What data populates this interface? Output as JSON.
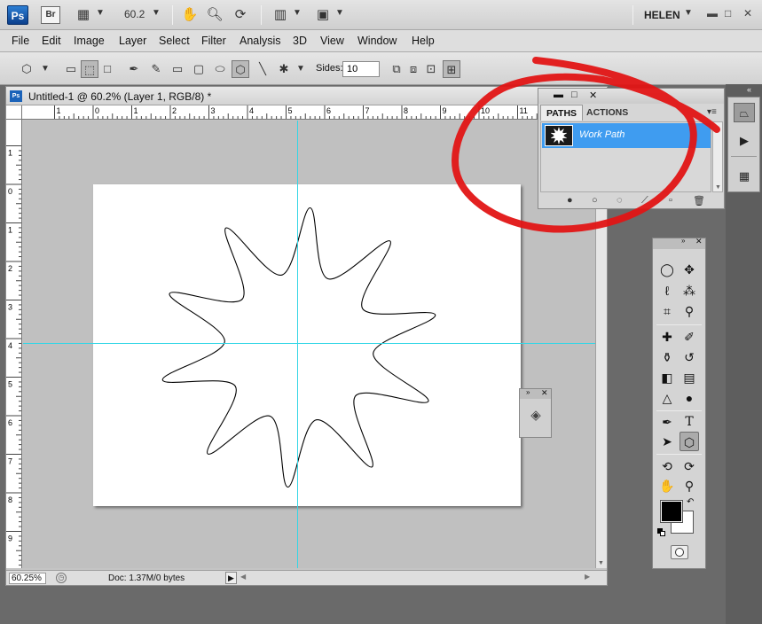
{
  "app_bar": {
    "ps_logo": "Ps",
    "br_logo": "Br",
    "zoom": "60.2",
    "username": "HELEN"
  },
  "menu": [
    "File",
    "Edit",
    "Image",
    "Layer",
    "Select",
    "Filter",
    "Analysis",
    "3D",
    "View",
    "Window",
    "Help"
  ],
  "options_bar": {
    "sides_label": "Sides:",
    "sides_value": "10"
  },
  "document": {
    "title": "Untitled-1 @ 60.2% (Layer 1, RGB/8) *",
    "zoom_status": "60.25%",
    "doc_info": "Doc: 1.37M/0 bytes",
    "ruler_h_labels": [
      "1",
      "0",
      "1",
      "2",
      "3",
      "4",
      "5",
      "6",
      "7",
      "8",
      "9",
      "10",
      "11"
    ],
    "ruler_v_labels": [
      "1",
      "0",
      "1",
      "2",
      "3",
      "4",
      "5",
      "6",
      "7",
      "8",
      "9"
    ]
  },
  "paths_panel": {
    "tabs": [
      "PATHS",
      "ACTIONS"
    ],
    "items": [
      {
        "label": "Work Path"
      }
    ]
  },
  "colors": {
    "accent_selection": "#3f9cf0",
    "guide": "#34d6e6",
    "annotation": "#e11515",
    "foreground": "#000000",
    "background": "#ffffff"
  }
}
